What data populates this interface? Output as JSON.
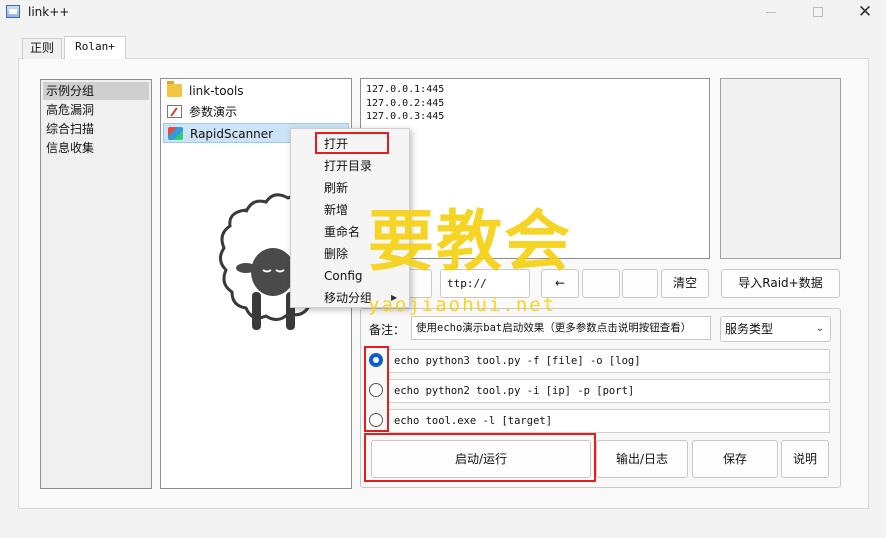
{
  "window": {
    "title": "link++",
    "minimize": "",
    "maximize": "",
    "close": "✕"
  },
  "tabs": [
    {
      "label": "正则"
    },
    {
      "label": "Rolan+"
    }
  ],
  "categories": [
    "示例分组",
    "高危漏洞",
    "综合扫描",
    "信息收集"
  ],
  "tools": [
    {
      "label": "link-tools",
      "icon": "folder-icon"
    },
    {
      "label": "参数演示",
      "icon": "document-icon"
    },
    {
      "label": "RapidScanner",
      "icon": "app-icon"
    }
  ],
  "targets": [
    "127.0.0.1:445",
    "127.0.0.2:445",
    "127.0.0.3:445"
  ],
  "button_row": {
    "url_value": "ttp://",
    "left_arrow": "←",
    "clear": "清空",
    "import": "导入Raid+数据"
  },
  "note": {
    "label": "备注：",
    "value": "使用echo演示bat启动效果（更多参数点击说明按钮查看）"
  },
  "service_select": {
    "value": "服务类型"
  },
  "commands": [
    {
      "text": "echo python3 tool.py -f [file] -o [log]",
      "selected": true
    },
    {
      "text": "echo python2 tool.py -i [ip] -p [port]",
      "selected": false
    },
    {
      "text": "echo tool.exe -l [target]",
      "selected": false
    }
  ],
  "bottom_buttons": {
    "run": "启动/运行",
    "output": "输出/日志",
    "save": "保存",
    "help": "说明"
  },
  "context_menu": [
    "打开",
    "打开目录",
    "刷新",
    "新增",
    "重命名",
    "删除",
    "Config",
    "移动分组"
  ],
  "context_submenu_arrow": "▶",
  "watermark": {
    "main": "要教会",
    "sub": "yaojiaohui.net"
  },
  "colors": {
    "accent": "#0a60c4",
    "highlight": "#e02020",
    "watermark": "#f5d014"
  }
}
